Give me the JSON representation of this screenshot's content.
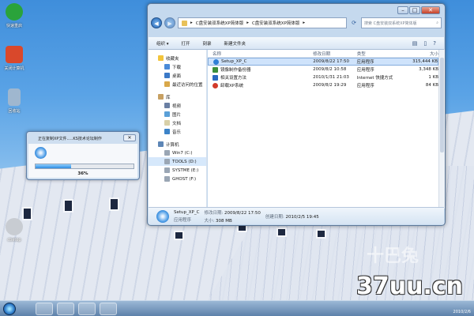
{
  "desktop": {
    "icons": [
      {
        "label": "快速重启",
        "color": "#2aa33b"
      },
      {
        "label": "关闭计算机",
        "color": "#d9482b"
      },
      {
        "label": "回收站",
        "color": "#9fb7cf"
      },
      {
        "label": "cbetop",
        "color": "#c8ccd2"
      }
    ]
  },
  "explorer": {
    "window_controls": {
      "minimize": "–",
      "maximize": "□",
      "close": "✕"
    },
    "address": {
      "segments": [
        "C盘安装双系统XP简体版",
        "C盘安装双系统XP简体版"
      ],
      "separator": "▸"
    },
    "search_placeholder": "搜索 C盘安装双系统XP简体版",
    "toolbar": {
      "organize": "组织 ▾",
      "open": "打开",
      "burn": "刻录",
      "new_folder": "新建文件夹"
    },
    "nav": {
      "favorites": "收藏夹",
      "favorites_items": [
        "下载",
        "桌面",
        "最近访问的位置"
      ],
      "libraries": "库",
      "library_items": [
        "视频",
        "图片",
        "文档",
        "音乐"
      ],
      "computer": "计算机",
      "drives": [
        "Win7 (C:)",
        "TOOLS (D:)",
        "SYSTME (E:)",
        "GHOST (F:)"
      ]
    },
    "columns": {
      "name": "名称",
      "date": "修改日期",
      "type": "类型",
      "size": "大小"
    },
    "files": [
      {
        "name": "Setup_XP_C",
        "date": "2009/8/22 17:50",
        "type": "应用程序",
        "size": "315,444 KB",
        "color": "#2f7fd6"
      },
      {
        "name": "镜像制作备份器",
        "date": "2009/8/2 10:58",
        "type": "应用程序",
        "size": "3,348 KB",
        "color": "#3b8f3b"
      },
      {
        "name": "相关设置方法",
        "date": "2010/1/31 21:03",
        "type": "Internet 快捷方式",
        "size": "1 KB",
        "color": "#2a6ac0"
      },
      {
        "name": "卸载XP系统",
        "date": "2009/8/2 19:29",
        "type": "应用程序",
        "size": "84 KB",
        "color": "#d23a2a"
      }
    ],
    "details": {
      "name": "Setup_XP_C",
      "type": "应用程序",
      "modified_label": "修改日期:",
      "modified": "2009/8/22 17:50",
      "size_label": "大小:",
      "size": "308 MB",
      "created_label": "创建日期:",
      "created": "2010/2/5 19:45"
    }
  },
  "copy_dialog": {
    "title": "正在复制XP文件.....KS技术论坛制作",
    "close": "✕",
    "progress_fraction": 0.36,
    "percent_label": "36%"
  },
  "watermark": {
    "site": "37uu.cn",
    "cn": "十巴兔"
  },
  "taskbar": {
    "clock": "2010/2/6"
  }
}
